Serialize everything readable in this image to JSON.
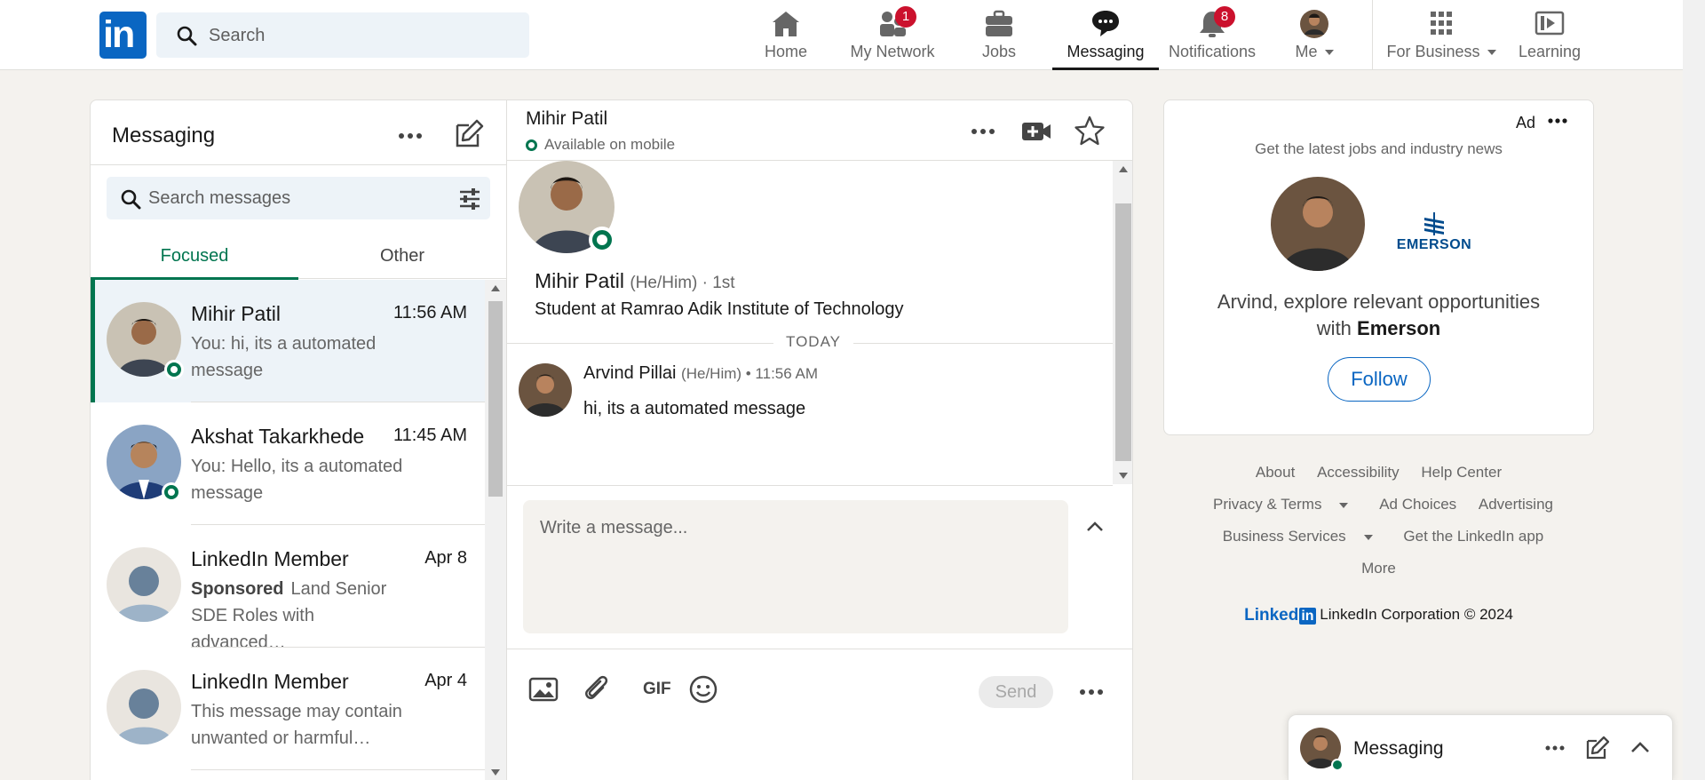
{
  "topnav": {
    "logo": "in",
    "search_placeholder": "Search",
    "items": [
      {
        "label": "Home",
        "icon": "home-icon"
      },
      {
        "label": "My Network",
        "icon": "network-icon",
        "badge": "1"
      },
      {
        "label": "Jobs",
        "icon": "briefcase-icon"
      },
      {
        "label": "Messaging",
        "icon": "messaging-icon",
        "active": true
      },
      {
        "label": "Notifications",
        "icon": "bell-icon",
        "badge": "8"
      },
      {
        "label": "Me",
        "icon": "avatar"
      },
      {
        "label": "For Business",
        "icon": "grid-icon"
      },
      {
        "label": "Learning",
        "icon": "learning-icon"
      }
    ]
  },
  "messaging": {
    "title": "Messaging",
    "search_placeholder": "Search messages",
    "tabs": [
      "Focused",
      "Other"
    ],
    "conversations": [
      {
        "name": "Mihir Patil",
        "time": "11:56 AM",
        "preview": "You: hi, its a automated message",
        "online": true,
        "selected": true
      },
      {
        "name": "Akshat Takarkhede",
        "time": "11:45 AM",
        "preview": "You: Hello, its a automated message",
        "online": true
      },
      {
        "name": "LinkedIn Member",
        "time": "Apr 8",
        "sponsored": "Sponsored",
        "preview": "Land Senior SDE Roles with advanced…"
      },
      {
        "name": "LinkedIn Member",
        "time": "Apr 4",
        "preview": "This message may contain unwanted or harmful…"
      }
    ]
  },
  "thread": {
    "name": "Mihir Patil",
    "status": "Available on mobile",
    "profile_name": "Mihir Patil",
    "profile_pronouns": "(He/Him) · 1st",
    "profile_headline": "Student at Ramrao Adik Institute of Technology",
    "day_label": "TODAY",
    "message": {
      "sender": "Arvind Pillai",
      "meta": "(He/Him) • 11:56 AM",
      "text": "hi, its a automated message"
    },
    "composer_placeholder": "Write a message...",
    "gif_label": "GIF",
    "send_label": "Send"
  },
  "ad": {
    "tag": "Ad",
    "subtitle": "Get the latest jobs and industry news",
    "company": "EMERSON",
    "copy_prefix": "Arvind, explore relevant opportunities with",
    "copy_company": "Emerson",
    "follow_label": "Follow"
  },
  "footer": {
    "row1": [
      "About",
      "Accessibility",
      "Help Center"
    ],
    "row2": [
      "Privacy & Terms",
      "Ad Choices",
      "Advertising"
    ],
    "row3": [
      "Business Services",
      "Get the LinkedIn app"
    ],
    "row4": [
      "More"
    ],
    "brand_word": "Linked",
    "brand_in": "in",
    "copyright": "LinkedIn Corporation © 2024"
  },
  "dock": {
    "title": "Messaging"
  },
  "colors": {
    "brand": "#0a66c2",
    "green": "#01754f",
    "badge": "#cb112d"
  }
}
